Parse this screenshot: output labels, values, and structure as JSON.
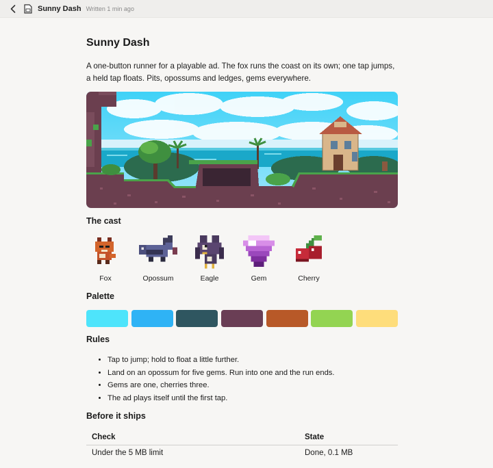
{
  "header": {
    "doc_title": "Sunny Dash",
    "written": "Written 1 min ago"
  },
  "doc": {
    "title": "Sunny Dash",
    "intro": "A one-button runner for a playable ad. The fox runs the coast on its own; one tap jumps, a held tap floats. Pits, opossums and ledges, gems everywhere."
  },
  "cast": {
    "heading": "The cast",
    "items": [
      {
        "label": "Fox",
        "icon": "fox-sprite"
      },
      {
        "label": "Opossum",
        "icon": "opossum-sprite"
      },
      {
        "label": "Eagle",
        "icon": "eagle-sprite"
      },
      {
        "label": "Gem",
        "icon": "gem-sprite"
      },
      {
        "label": "Cherry",
        "icon": "cherry-sprite"
      }
    ]
  },
  "palette": {
    "heading": "Palette",
    "colors": [
      "#4ee4fb",
      "#2fb3f5",
      "#2f5660",
      "#6a3e55",
      "#b85928",
      "#93d452",
      "#fedd7b"
    ]
  },
  "rules": {
    "heading": "Rules",
    "items": [
      "Tap to jump; hold to float a little further.",
      "Land on an opossum for five gems. Run into one and the run ends.",
      "Gems are one, cherries three.",
      "The ad plays itself until the first tap."
    ]
  },
  "checks": {
    "heading": "Before it ships",
    "columns": [
      "Check",
      "State"
    ],
    "rows": [
      [
        "Under the 5 MB limit",
        "Done, 0.1 MB"
      ]
    ]
  }
}
